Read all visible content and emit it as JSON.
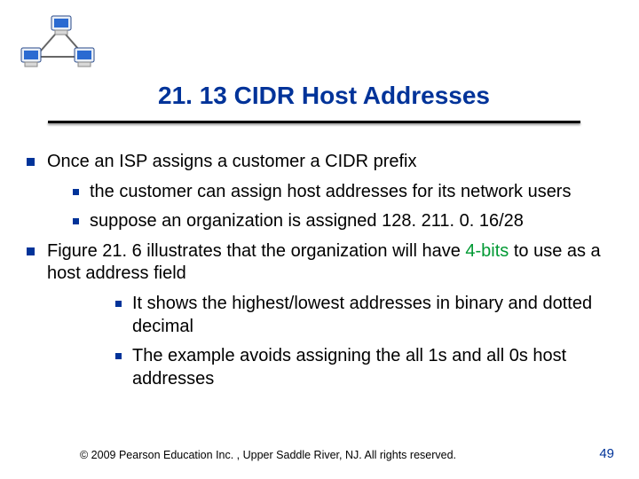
{
  "title": "21. 13  CIDR Host Addresses",
  "bullets": {
    "l1_a": "Once an ISP assigns a customer a CIDR prefix",
    "l2_a": "the customer can assign host addresses for its network users",
    "l2_b_prefix": "suppose an organization is assigned ",
    "l2_b_value": "128. 211. 0. 16/28",
    "l1_b_prefix": "Figure 21. 6 illustrates that the organization will have ",
    "l1_b_green": "4-bits",
    "l1_b_suffix": " to use as a host address field",
    "l3_a": "It shows the highest/lowest addresses in binary and dotted decimal",
    "l3_b": "The example avoids assigning the all 1s and all 0s host addresses"
  },
  "footer": "© 2009 Pearson Education Inc. , Upper Saddle River, NJ. All rights reserved.",
  "page": "49",
  "colors": {
    "accent": "#003399",
    "green": "#009933"
  }
}
